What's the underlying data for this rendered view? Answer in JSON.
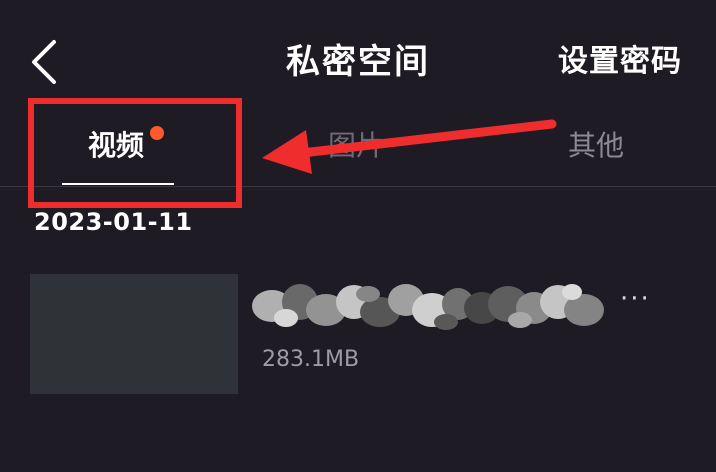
{
  "header": {
    "title": "私密空间",
    "set_password_label": "设置密码"
  },
  "tabs": [
    {
      "label": "视频",
      "active": true,
      "has_badge": true
    },
    {
      "label": "图片",
      "active": false
    },
    {
      "label": "其他",
      "active": false
    }
  ],
  "content": {
    "date": "2023-01-11",
    "items": [
      {
        "size": "283.1MB",
        "more_label": "···"
      }
    ]
  },
  "colors": {
    "background": "#1f1b25",
    "badge": "#ff5a2c",
    "annotation": "#ef2d2d",
    "thumbnail": "#2f3337"
  },
  "icons": {
    "back": "chevron-left-icon",
    "more": "more-horizontal-icon"
  }
}
